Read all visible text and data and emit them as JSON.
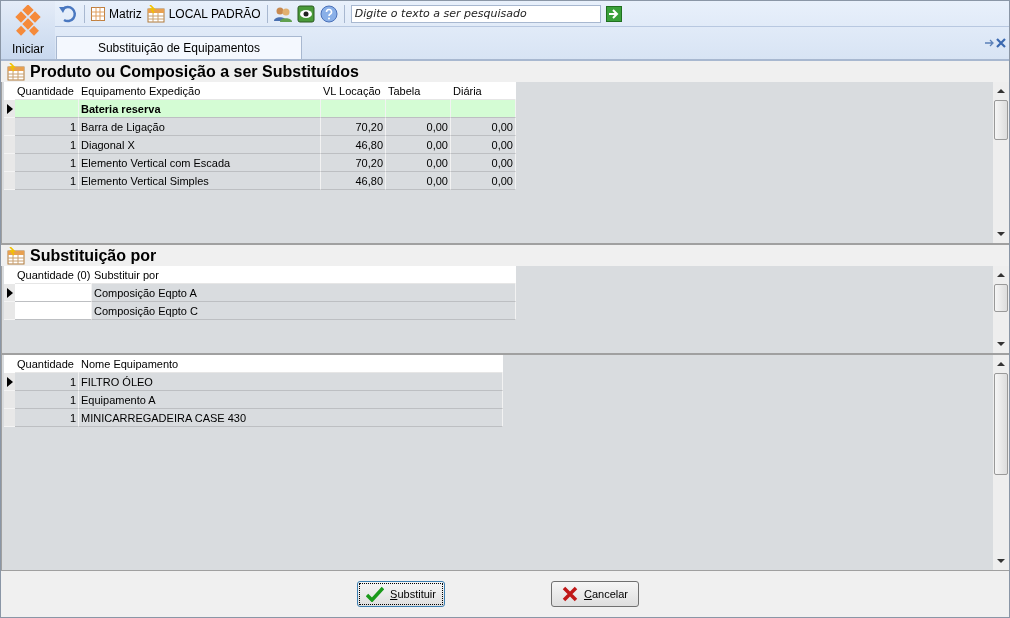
{
  "toolbar": {
    "start_label": "Iniciar",
    "branch": "Matriz",
    "location": "LOCAL PADRÃO",
    "search": {
      "placeholder": "Digite o texto a ser pesquisado"
    }
  },
  "tabs": [
    {
      "label": "Substituição de Equipamentos",
      "selected": true
    }
  ],
  "sections": [
    {
      "title": "Produto ou Composição a ser Substituídos",
      "grids": [
        {
          "columns": [
            "Quantidade",
            "Equipamento Expedição",
            "VL Locação",
            "Tabela",
            "Diária"
          ],
          "rows": [
            {
              "kind": "group",
              "current": true,
              "cells": [
                null,
                "Bateria reserva",
                null,
                null,
                null
              ]
            },
            {
              "kind": "item",
              "current": false,
              "cells": [
                "1",
                "Barra de Ligação",
                "70,20",
                "0,00",
                "0,00"
              ]
            },
            {
              "kind": "item",
              "current": false,
              "cells": [
                "1",
                "Diagonal X",
                "46,80",
                "0,00",
                "0,00"
              ]
            },
            {
              "kind": "item",
              "current": false,
              "cells": [
                "1",
                "Elemento Vertical com Escada",
                "70,20",
                "0,00",
                "0,00"
              ]
            },
            {
              "kind": "item",
              "current": false,
              "cells": [
                "1",
                "Elemento Vertical Simples",
                "46,80",
                "0,00",
                "0,00"
              ]
            }
          ]
        }
      ]
    },
    {
      "title": "Substituição por",
      "grids": [
        {
          "columns": [
            "Quantidade (0)",
            "Substituir por"
          ],
          "rows": [
            {
              "kind": "item",
              "current": true,
              "cells": [
                null,
                "Composição Eqpto A"
              ]
            },
            {
              "kind": "item",
              "current": false,
              "cells": [
                null,
                "Composição Eqpto C"
              ]
            }
          ]
        },
        {
          "columns": [
            "Quantidade",
            "Nome Equipamento"
          ],
          "rows": [
            {
              "kind": "item",
              "current": true,
              "cells": [
                "1",
                "FILTRO ÓLEO"
              ]
            },
            {
              "kind": "item",
              "current": false,
              "cells": [
                "1",
                "Equipamento A"
              ]
            },
            {
              "kind": "item",
              "current": false,
              "cells": [
                "1",
                "MINICARREGADEIRA CASE 430"
              ]
            }
          ]
        }
      ]
    }
  ],
  "buttons": [
    {
      "label": "Substituir",
      "kind": "confirm",
      "focused": true
    },
    {
      "label": "Cancelar",
      "kind": "cancel",
      "focused": false
    }
  ]
}
